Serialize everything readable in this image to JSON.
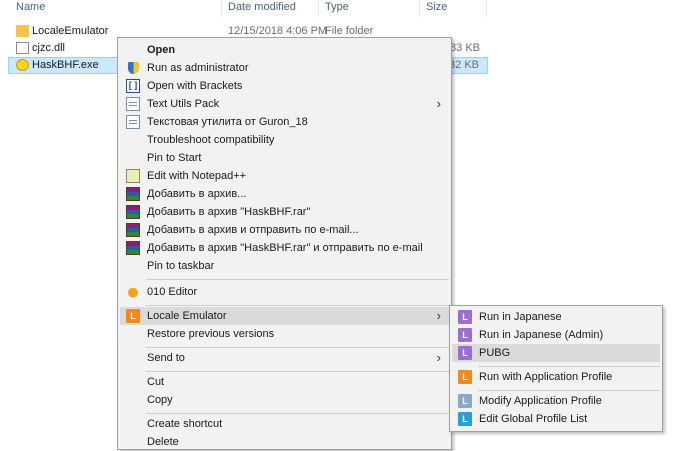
{
  "columns": {
    "name": "Name",
    "date": "Date modified",
    "type": "Type",
    "size": "Size"
  },
  "files": [
    {
      "name": "LocaleEmulator",
      "date": "12/15/2018 4:06 PM",
      "type": "File folder",
      "size": "",
      "icon": "folder-icon"
    },
    {
      "name": "cjzc.dll",
      "date": "",
      "type": "",
      "size": "183 KB",
      "icon": "dll-file-icon"
    },
    {
      "name": "HaskBHF.exe",
      "date": "",
      "type": "",
      "size": "532 KB",
      "icon": "smiley-exe-icon"
    }
  ],
  "context_menu": {
    "items": [
      {
        "label": "Open",
        "bold": true,
        "icon": ""
      },
      {
        "label": "Run as administrator",
        "icon": "uac-shield-icon"
      },
      {
        "label": "Open with Brackets",
        "icon": "brackets-icon"
      },
      {
        "label": "Text Utils Pack",
        "icon": "document-icon",
        "submenu": true
      },
      {
        "label": "Текстовая утилита от Guron_18",
        "icon": "document-icon"
      },
      {
        "label": "Troubleshoot compatibility",
        "icon": ""
      },
      {
        "label": "Pin to Start",
        "icon": ""
      },
      {
        "label": "Edit with Notepad++",
        "icon": "notepad-plus-plus-icon"
      },
      {
        "label": "Добавить в архив...",
        "icon": "winrar-icon"
      },
      {
        "label": "Добавить в архив \"HaskBHF.rar\"",
        "icon": "winrar-icon"
      },
      {
        "label": "Добавить в архив и отправить по e-mail...",
        "icon": "winrar-icon"
      },
      {
        "label": "Добавить в архив \"HaskBHF.rar\" и отправить по e-mail",
        "icon": "winrar-icon"
      },
      {
        "label": "Pin to taskbar",
        "icon": ""
      },
      {
        "label": "010 Editor",
        "icon": "010-editor-icon"
      },
      {
        "label": "Locale Emulator",
        "icon": "locale-emulator-icon",
        "submenu": true,
        "highlighted": true
      },
      {
        "label": "Restore previous versions",
        "icon": ""
      },
      {
        "label": "Send to",
        "icon": "",
        "submenu": true
      },
      {
        "label": "Cut",
        "icon": ""
      },
      {
        "label": "Copy",
        "icon": ""
      },
      {
        "label": "Create shortcut",
        "icon": ""
      },
      {
        "label": "Delete",
        "icon": ""
      }
    ]
  },
  "submenu": {
    "items": [
      {
        "label": "Run in Japanese",
        "icon": "locale-emulator-purple-icon"
      },
      {
        "label": "Run in Japanese (Admin)",
        "icon": "locale-emulator-purple-icon"
      },
      {
        "label": "PUBG",
        "icon": "locale-emulator-purple-icon",
        "highlighted": true
      },
      {
        "label": "Run with Application Profile",
        "icon": "locale-emulator-orange-icon"
      },
      {
        "label": "Modify Application Profile",
        "icon": "locale-emulator-gray-icon"
      },
      {
        "label": "Edit Global Profile List",
        "icon": "locale-emulator-blue-icon"
      }
    ]
  },
  "glyphs": {
    "submenu_arrow": "›",
    "le_letter": "L",
    "brackets": "[ ]"
  },
  "colors": {
    "selection": "#cce8ff",
    "menu_bg": "#f2f2f2",
    "menu_highlight": "#dadada"
  }
}
